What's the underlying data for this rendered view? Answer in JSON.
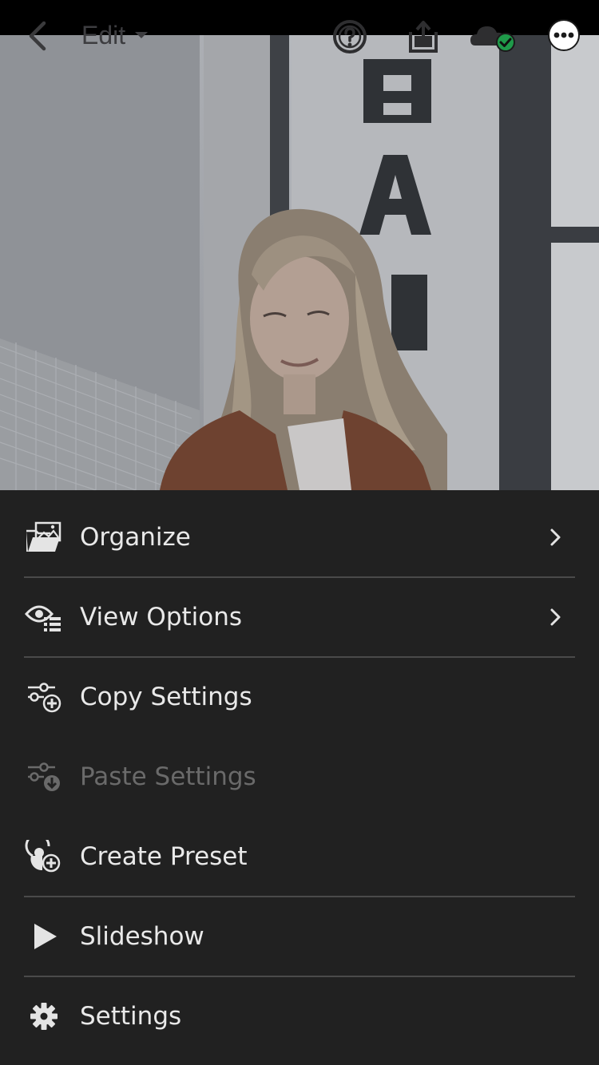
{
  "topbar": {
    "edit_label": "Edit",
    "icons": [
      "back-arrow-icon",
      "help-icon",
      "share-icon",
      "cloud-synced-icon",
      "more-icon"
    ]
  },
  "photo": {
    "description_icon": "photo-image",
    "sign_letters": [
      "B",
      "A"
    ]
  },
  "menu": {
    "items": [
      {
        "label": "Organize",
        "icon": "folder-image-icon",
        "has_submenu": true,
        "enabled": true
      },
      {
        "label": "View Options",
        "icon": "eye-list-icon",
        "has_submenu": true,
        "enabled": true
      },
      {
        "label": "Copy Settings",
        "icon": "sliders-plus-icon",
        "has_submenu": false,
        "enabled": true
      },
      {
        "label": "Paste Settings",
        "icon": "sliders-download-icon",
        "has_submenu": false,
        "enabled": false
      },
      {
        "label": "Create Preset",
        "icon": "preset-plus-icon",
        "has_submenu": false,
        "enabled": true
      },
      {
        "label": "Slideshow",
        "icon": "play-icon",
        "has_submenu": false,
        "enabled": true
      },
      {
        "label": "Settings",
        "icon": "gear-icon",
        "has_submenu": false,
        "enabled": true
      }
    ]
  },
  "colors": {
    "menu_bg": "#212121",
    "text": "#e9e9e9",
    "disabled_text": "#6a6a6a",
    "divider": "#4a4a4a",
    "sync_green": "#1f9a4a"
  }
}
